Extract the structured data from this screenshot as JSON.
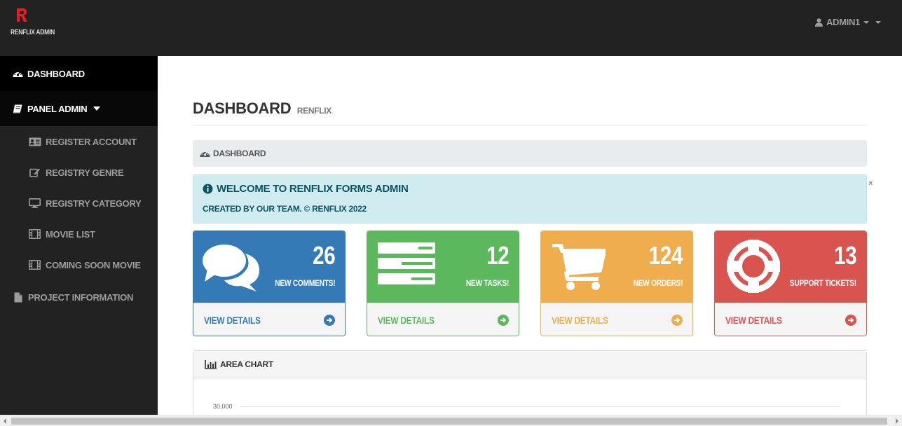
{
  "app": {
    "brand": "RENFLIX ADMIN"
  },
  "header": {
    "user_label": "ADMIN1"
  },
  "sidebar": {
    "dashboard": "DASHBOARD",
    "panel_admin": "PANEL ADMIN",
    "items": [
      {
        "label": "REGISTER ACCOUNT",
        "icon": "id-card-icon"
      },
      {
        "label": "REGISTRY GENRE",
        "icon": "edit-icon"
      },
      {
        "label": "REGISTRY CATEGORY",
        "icon": "desktop-icon"
      },
      {
        "label": "MOVIE LIST",
        "icon": "film-icon"
      },
      {
        "label": "COMING SOON MOVIE",
        "icon": "film-icon"
      }
    ],
    "project_info": "PROJECT INFORMATION"
  },
  "page": {
    "title": "DASHBOARD",
    "subtitle": "RENFLIX"
  },
  "breadcrumb": {
    "label": "DASHBOARD"
  },
  "alert": {
    "title": "WELCOME TO RENFLIX FORMS ADMIN",
    "text": "CREATED BY OUR TEAM. © RENFLIX 2022",
    "close": "×"
  },
  "cards": [
    {
      "value": "26",
      "label": "NEW COMMENTS!",
      "link": "VIEW DETAILS",
      "color": "#337ab7",
      "icon": "comments-icon"
    },
    {
      "value": "12",
      "label": "NEW TASKS!",
      "link": "VIEW DETAILS",
      "color": "#5cb85c",
      "icon": "tasks-icon"
    },
    {
      "value": "124",
      "label": "NEW ORDERS!",
      "link": "VIEW DETAILS",
      "color": "#f0ad4e",
      "icon": "shopping-cart-icon"
    },
    {
      "value": "13",
      "label": "SUPPORT TICKETS!",
      "link": "VIEW DETAILS",
      "color": "#d9534f",
      "icon": "support-icon"
    }
  ],
  "chart": {
    "title": "AREA CHART",
    "y_tick_top": "30,000"
  }
}
